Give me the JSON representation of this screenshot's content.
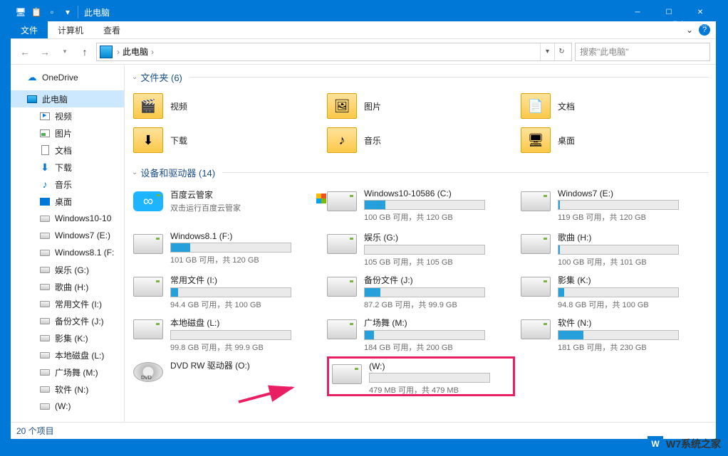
{
  "window": {
    "title": "此电脑",
    "ribbon_tabs": [
      "文件",
      "计算机",
      "查看"
    ],
    "active_tab": 0
  },
  "nav": {
    "breadcrumb_root": "此电脑",
    "search_placeholder": "搜索\"此电脑\""
  },
  "sidebar": {
    "onedrive": "OneDrive",
    "thispc": "此电脑",
    "items": [
      {
        "label": "视频",
        "icon": "video"
      },
      {
        "label": "图片",
        "icon": "pic"
      },
      {
        "label": "文档",
        "icon": "doc"
      },
      {
        "label": "下载",
        "icon": "dl"
      },
      {
        "label": "音乐",
        "icon": "music"
      },
      {
        "label": "桌面",
        "icon": "desktop"
      },
      {
        "label": "Windows10-10",
        "icon": "drive"
      },
      {
        "label": "Windows7 (E:)",
        "icon": "drive"
      },
      {
        "label": "Windows8.1 (F:",
        "icon": "drive"
      },
      {
        "label": "娱乐 (G:)",
        "icon": "drive"
      },
      {
        "label": "歌曲 (H:)",
        "icon": "drive"
      },
      {
        "label": "常用文件 (I:)",
        "icon": "drive"
      },
      {
        "label": "备份文件 (J:)",
        "icon": "drive"
      },
      {
        "label": "影集 (K:)",
        "icon": "drive"
      },
      {
        "label": "本地磁盘 (L:)",
        "icon": "drive"
      },
      {
        "label": "广场舞 (M:)",
        "icon": "drive"
      },
      {
        "label": "软件 (N:)",
        "icon": "drive"
      },
      {
        "label": " (W:)",
        "icon": "drive"
      }
    ]
  },
  "groups": {
    "folders": {
      "title": "文件夹 (6)",
      "items": [
        {
          "label": "视频",
          "glyph": "🎬"
        },
        {
          "label": "图片",
          "glyph": "🖼"
        },
        {
          "label": "文档",
          "glyph": "📄"
        },
        {
          "label": "下载",
          "glyph": "⬇"
        },
        {
          "label": "音乐",
          "glyph": "♪"
        },
        {
          "label": "桌面",
          "glyph": "🖥"
        }
      ]
    },
    "devices": {
      "title": "设备和驱动器 (14)",
      "baidu": {
        "title": "百度云管家",
        "sub": "双击运行百度云管家"
      },
      "drives": [
        {
          "title": "Windows10-10586 (C:)",
          "stats": "100 GB 可用，共 120 GB",
          "fill": 17,
          "win": true
        },
        {
          "title": "Windows7 (E:)",
          "stats": "119 GB 可用，共 120 GB",
          "fill": 1
        },
        {
          "title": "Windows8.1 (F:)",
          "stats": "101 GB 可用，共 120 GB",
          "fill": 16
        },
        {
          "title": "娱乐 (G:)",
          "stats": "105 GB 可用，共 105 GB",
          "fill": 0
        },
        {
          "title": "歌曲 (H:)",
          "stats": "100 GB 可用，共 101 GB",
          "fill": 1
        },
        {
          "title": "常用文件 (I:)",
          "stats": "94.4 GB 可用，共 100 GB",
          "fill": 6
        },
        {
          "title": "备份文件 (J:)",
          "stats": "87.2 GB 可用，共 99.9 GB",
          "fill": 13
        },
        {
          "title": "影集 (K:)",
          "stats": "94.8 GB 可用，共 100 GB",
          "fill": 5
        },
        {
          "title": "本地磁盘 (L:)",
          "stats": "99.8 GB 可用，共 99.9 GB",
          "fill": 0
        },
        {
          "title": "广场舞 (M:)",
          "stats": "184 GB 可用，共 200 GB",
          "fill": 8
        },
        {
          "title": "软件 (N:)",
          "stats": "181 GB 可用，共 230 GB",
          "fill": 21
        }
      ],
      "dvd": {
        "title": "DVD RW 驱动器 (O:)"
      },
      "highlighted": {
        "title": " (W:)",
        "stats": "479 MB 可用，共 479 MB",
        "fill": 0
      }
    }
  },
  "statusbar": {
    "count": "20 个项目"
  },
  "watermark": {
    "top": "www.w7xitong.com",
    "bottom": "W7系统之家"
  }
}
